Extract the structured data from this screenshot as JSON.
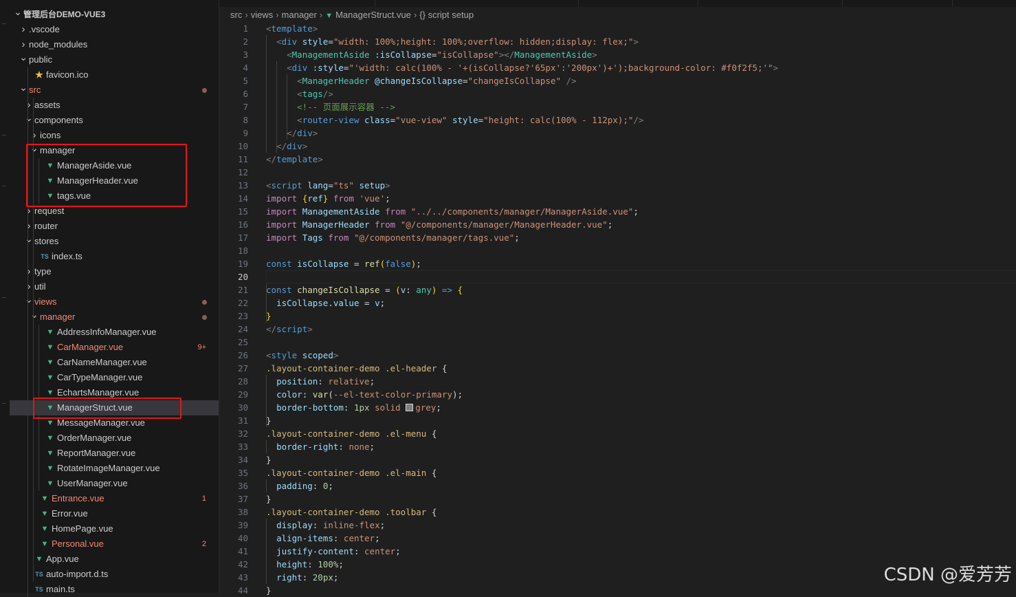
{
  "explorer": {
    "rows": [
      {
        "label": "管理后台DEMO-VUE3",
        "depth": 0,
        "kind": "folder",
        "open": true,
        "root": true
      },
      {
        "label": ".vscode",
        "depth": 1,
        "kind": "folder",
        "open": false
      },
      {
        "label": "node_modules",
        "depth": 1,
        "kind": "folder",
        "open": false
      },
      {
        "label": "public",
        "depth": 1,
        "kind": "folder",
        "open": true
      },
      {
        "label": "favicon.ico",
        "depth": 2,
        "kind": "star"
      },
      {
        "label": "src",
        "depth": 1,
        "kind": "folder",
        "open": true,
        "error": true,
        "dot": true
      },
      {
        "label": "assets",
        "depth": 2,
        "kind": "folder",
        "open": false
      },
      {
        "label": "components",
        "depth": 2,
        "kind": "folder",
        "open": true
      },
      {
        "label": "icons",
        "depth": 3,
        "kind": "folder",
        "open": false
      },
      {
        "label": "manager",
        "depth": 3,
        "kind": "folder",
        "open": true
      },
      {
        "label": "ManagerAside.vue",
        "depth": 4,
        "kind": "vue"
      },
      {
        "label": "ManagerHeader.vue",
        "depth": 4,
        "kind": "vue"
      },
      {
        "label": "tags.vue",
        "depth": 4,
        "kind": "vue"
      },
      {
        "label": "request",
        "depth": 2,
        "kind": "folder",
        "open": false
      },
      {
        "label": "router",
        "depth": 2,
        "kind": "folder",
        "open": false
      },
      {
        "label": "stores",
        "depth": 2,
        "kind": "folder",
        "open": true
      },
      {
        "label": "index.ts",
        "depth": 3,
        "kind": "ts"
      },
      {
        "label": "type",
        "depth": 2,
        "kind": "folder",
        "open": false
      },
      {
        "label": "util",
        "depth": 2,
        "kind": "folder",
        "open": false
      },
      {
        "label": "views",
        "depth": 2,
        "kind": "folder",
        "open": true,
        "error": true,
        "dot": true
      },
      {
        "label": "manager",
        "depth": 3,
        "kind": "folder",
        "open": true,
        "error": true,
        "dot": true
      },
      {
        "label": "AddressInfoManager.vue",
        "depth": 4,
        "kind": "vue"
      },
      {
        "label": "CarManager.vue",
        "depth": 4,
        "kind": "vue",
        "error": true,
        "badge": "9+"
      },
      {
        "label": "CarNameManager.vue",
        "depth": 4,
        "kind": "vue"
      },
      {
        "label": "CarTypeManager.vue",
        "depth": 4,
        "kind": "vue"
      },
      {
        "label": "EchartsManager.vue",
        "depth": 4,
        "kind": "vue"
      },
      {
        "label": "ManagerStruct.vue",
        "depth": 4,
        "kind": "vue",
        "selected": true
      },
      {
        "label": "MessageManager.vue",
        "depth": 4,
        "kind": "vue"
      },
      {
        "label": "OrderManager.vue",
        "depth": 4,
        "kind": "vue"
      },
      {
        "label": "ReportManager.vue",
        "depth": 4,
        "kind": "vue"
      },
      {
        "label": "RotateImageManager.vue",
        "depth": 4,
        "kind": "vue"
      },
      {
        "label": "UserManager.vue",
        "depth": 4,
        "kind": "vue"
      },
      {
        "label": "Entrance.vue",
        "depth": 3,
        "kind": "vue",
        "error": true,
        "badge": "1"
      },
      {
        "label": "Error.vue",
        "depth": 3,
        "kind": "vue"
      },
      {
        "label": "HomePage.vue",
        "depth": 3,
        "kind": "vue"
      },
      {
        "label": "Personal.vue",
        "depth": 3,
        "kind": "vue",
        "error": true,
        "badge": "2"
      },
      {
        "label": "App.vue",
        "depth": 2,
        "kind": "vue"
      },
      {
        "label": "auto-import.d.ts",
        "depth": 2,
        "kind": "ts"
      },
      {
        "label": "main.ts",
        "depth": 2,
        "kind": "ts"
      }
    ]
  },
  "breadcrumb": {
    "parts": [
      "src",
      "views",
      "manager"
    ],
    "file": "ManagerStruct.vue",
    "symbol": "{} script setup"
  },
  "editor": {
    "current_line": 20,
    "lines": [
      [
        [
          "<",
          "br"
        ],
        [
          "template",
          "tag"
        ],
        [
          ">",
          "br"
        ]
      ],
      [
        [
          "  "
        ],
        [
          "<",
          "br"
        ],
        [
          "div ",
          "tag"
        ],
        [
          "style",
          "attr"
        ],
        [
          "=",
          ""
        ],
        [
          "\"width: 100%;height: 100%;overflow: hidden;display: flex;\"",
          "str"
        ],
        [
          ">",
          "br"
        ]
      ],
      [
        [
          "    "
        ],
        [
          "<",
          "br"
        ],
        [
          "ManagementAside ",
          "cmp"
        ],
        [
          ":isCollapse",
          "attr"
        ],
        [
          "=",
          ""
        ],
        [
          "\"isCollapse\"",
          "str"
        ],
        [
          "></",
          "br"
        ],
        [
          "ManagementAside",
          "cmp"
        ],
        [
          ">",
          "br"
        ]
      ],
      [
        [
          "    "
        ],
        [
          "<",
          "br"
        ],
        [
          "div ",
          "tag"
        ],
        [
          ":style",
          "attr"
        ],
        [
          "=",
          ""
        ],
        [
          "\"'width: calc(100% - '+(isCollapse?'65px':'200px')+');background-color: #f0f2f5;'\"",
          "str"
        ],
        [
          ">",
          "br"
        ]
      ],
      [
        [
          "      "
        ],
        [
          "<",
          "br"
        ],
        [
          "ManagerHeader ",
          "cmp"
        ],
        [
          "@changeIsCollapse",
          "attr"
        ],
        [
          "=",
          ""
        ],
        [
          "\"changeIsCollapse\"",
          "str"
        ],
        [
          " />",
          "br"
        ]
      ],
      [
        [
          "      "
        ],
        [
          "<",
          "br"
        ],
        [
          "tags",
          "cmp"
        ],
        [
          "/>",
          "br"
        ]
      ],
      [
        [
          "      "
        ],
        [
          "<!-- 页面展示容器 -->",
          "com"
        ]
      ],
      [
        [
          "      "
        ],
        [
          "<",
          "br"
        ],
        [
          "router-view ",
          "tag"
        ],
        [
          "class",
          "attr"
        ],
        [
          "=",
          ""
        ],
        [
          "\"vue-view\"",
          "str"
        ],
        [
          " ",
          ""
        ],
        [
          "style",
          "attr"
        ],
        [
          "=",
          ""
        ],
        [
          "\"height: calc(100% - 112px);\"",
          "str"
        ],
        [
          "/>",
          "br"
        ]
      ],
      [
        [
          "    "
        ],
        [
          "</",
          "br"
        ],
        [
          "div",
          "tag"
        ],
        [
          ">",
          "br"
        ]
      ],
      [
        [
          "  "
        ],
        [
          "</",
          "br"
        ],
        [
          "div",
          "tag"
        ],
        [
          ">",
          "br"
        ]
      ],
      [
        [
          "</",
          "br"
        ],
        [
          "template",
          "tag"
        ],
        [
          ">",
          "br"
        ]
      ],
      [
        [
          ""
        ]
      ],
      [
        [
          "<",
          "br"
        ],
        [
          "script ",
          "tag"
        ],
        [
          "lang",
          "attr"
        ],
        [
          "=",
          ""
        ],
        [
          "\"ts\"",
          "str"
        ],
        [
          " ",
          ""
        ],
        [
          "setup",
          "attr"
        ],
        [
          ">",
          "br"
        ]
      ],
      [
        [
          "import ",
          "key"
        ],
        [
          "{",
          "p1"
        ],
        [
          "ref",
          "var"
        ],
        [
          "}",
          "p1"
        ],
        [
          " from ",
          "key"
        ],
        [
          "'vue'",
          "str"
        ],
        [
          ";",
          ""
        ]
      ],
      [
        [
          "import ",
          "key"
        ],
        [
          "ManagementAside",
          "var"
        ],
        [
          " from ",
          "key"
        ],
        [
          "\"../../components/manager/ManagerAside.vue\"",
          "str"
        ],
        [
          ";",
          ""
        ]
      ],
      [
        [
          "import ",
          "key"
        ],
        [
          "ManagerHeader",
          "var"
        ],
        [
          " from ",
          "key"
        ],
        [
          "\"@/components/manager/ManagerHeader.vue\"",
          "str"
        ],
        [
          ";",
          ""
        ]
      ],
      [
        [
          "import ",
          "key"
        ],
        [
          "Tags",
          "var"
        ],
        [
          " from ",
          "key"
        ],
        [
          "\"@/components/manager/tags.vue\"",
          "str"
        ],
        [
          ";",
          ""
        ]
      ],
      [
        [
          ""
        ]
      ],
      [
        [
          "const ",
          "kw"
        ],
        [
          "isCollapse",
          "var"
        ],
        [
          " = ",
          ""
        ],
        [
          "ref",
          "fn"
        ],
        [
          "(",
          "p1"
        ],
        [
          "false",
          "kw"
        ],
        [
          ")",
          "p1"
        ],
        [
          ";",
          ""
        ]
      ],
      [
        [
          ""
        ]
      ],
      [
        [
          "const ",
          "kw"
        ],
        [
          "changeIsCollapse",
          "fn"
        ],
        [
          " = ",
          ""
        ],
        [
          "(",
          "p1"
        ],
        [
          "v",
          "var"
        ],
        [
          ": ",
          ""
        ],
        [
          "any",
          "cmp"
        ],
        [
          ")",
          "p1"
        ],
        [
          " => ",
          "kw"
        ],
        [
          "{",
          "p1"
        ]
      ],
      [
        [
          "  "
        ],
        [
          "isCollapse",
          "var"
        ],
        [
          ".",
          ""
        ],
        [
          "value",
          "var"
        ],
        [
          " = ",
          ""
        ],
        [
          "v",
          "var"
        ],
        [
          ";",
          ""
        ]
      ],
      [
        [
          "}",
          "p1"
        ]
      ],
      [
        [
          "</",
          "br"
        ],
        [
          "script",
          "tag"
        ],
        [
          ">",
          "br"
        ]
      ],
      [
        [
          ""
        ]
      ],
      [
        [
          "<",
          "br"
        ],
        [
          "style ",
          "tag"
        ],
        [
          "scoped",
          "attr"
        ],
        [
          ">",
          "br"
        ]
      ],
      [
        [
          ".layout-container-demo .el-header ",
          "sel"
        ],
        [
          "{",
          ""
        ]
      ],
      [
        [
          "  "
        ],
        [
          "position",
          "attr"
        ],
        [
          ": ",
          ""
        ],
        [
          "relative",
          "str"
        ],
        [
          ";",
          ""
        ]
      ],
      [
        [
          "  "
        ],
        [
          "color",
          "attr"
        ],
        [
          ": ",
          ""
        ],
        [
          "var",
          "fn"
        ],
        [
          "(",
          ""
        ],
        [
          "--el-text-color-primary",
          "str"
        ],
        [
          ")",
          ""
        ],
        [
          ";",
          ""
        ]
      ],
      [
        [
          "  "
        ],
        [
          "border-bottom",
          "attr"
        ],
        [
          ": ",
          ""
        ],
        [
          "1px ",
          "num"
        ],
        [
          "solid ",
          "str"
        ],
        [
          "",
          "swatch"
        ],
        [
          "grey",
          "str"
        ],
        [
          ";",
          ""
        ]
      ],
      [
        [
          "}",
          ""
        ]
      ],
      [
        [
          ".layout-container-demo .el-menu ",
          "sel"
        ],
        [
          "{",
          ""
        ]
      ],
      [
        [
          "  "
        ],
        [
          "border-right",
          "attr"
        ],
        [
          ": ",
          ""
        ],
        [
          "none",
          "str"
        ],
        [
          ";",
          ""
        ]
      ],
      [
        [
          "}",
          ""
        ]
      ],
      [
        [
          ".layout-container-demo .el-main ",
          "sel"
        ],
        [
          "{",
          ""
        ]
      ],
      [
        [
          "  "
        ],
        [
          "padding",
          "attr"
        ],
        [
          ": ",
          ""
        ],
        [
          "0",
          "num"
        ],
        [
          ";",
          ""
        ]
      ],
      [
        [
          "}",
          ""
        ]
      ],
      [
        [
          ".layout-container-demo .toolbar ",
          "sel"
        ],
        [
          "{",
          ""
        ]
      ],
      [
        [
          "  "
        ],
        [
          "display",
          "attr"
        ],
        [
          ": ",
          ""
        ],
        [
          "inline-flex",
          "str"
        ],
        [
          ";",
          ""
        ]
      ],
      [
        [
          "  "
        ],
        [
          "align-items",
          "attr"
        ],
        [
          ": ",
          ""
        ],
        [
          "center",
          "str"
        ],
        [
          ";",
          ""
        ]
      ],
      [
        [
          "  "
        ],
        [
          "justify-content",
          "attr"
        ],
        [
          ": ",
          ""
        ],
        [
          "center",
          "str"
        ],
        [
          ";",
          ""
        ]
      ],
      [
        [
          "  "
        ],
        [
          "height",
          "attr"
        ],
        [
          ": ",
          ""
        ],
        [
          "100%",
          "num"
        ],
        [
          ";",
          ""
        ]
      ],
      [
        [
          "  "
        ],
        [
          "right",
          "attr"
        ],
        [
          ": ",
          ""
        ],
        [
          "20px",
          "num"
        ],
        [
          ";",
          ""
        ]
      ],
      [
        [
          "}",
          ""
        ]
      ]
    ]
  },
  "watermark": "CSDN @爱芳芳",
  "icons": {
    "folder_open": "chevron-down-icon",
    "folder_closed": "chevron-right-icon",
    "vue": "vue-file-icon",
    "ts": "typescript-file-icon",
    "star": "favicon-star-icon"
  },
  "colors": {
    "accent_vue": "#41b883",
    "error": "#f48771",
    "highlight_box": "#e3171b"
  }
}
